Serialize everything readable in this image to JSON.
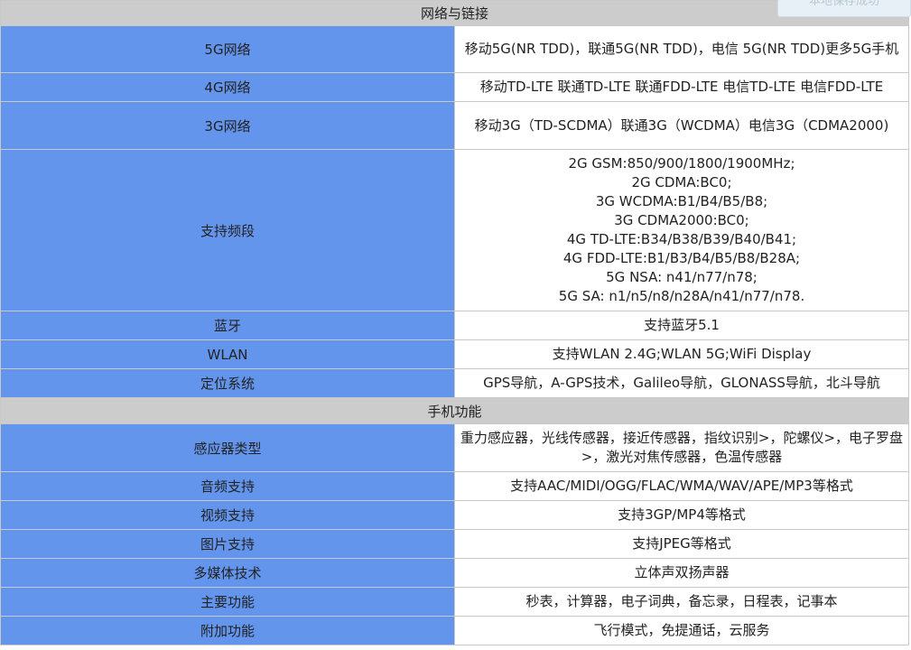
{
  "sections": [
    {
      "title": "网络与链接",
      "rows": [
        {
          "key": "5G网络",
          "value": "移动5G(NR TDD)，联通5G(NR TDD)，电信 5G(NR TDD)更多5G手机"
        },
        {
          "key": "4G网络",
          "value": "移动TD-LTE 联通TD-LTE 联通FDD-LTE 电信TD-LTE 电信FDD-LTE"
        },
        {
          "key": "3G网络",
          "value": "移动3G（TD-SCDMA）联通3G（WCDMA）电信3G（CDMA2000)"
        },
        {
          "key": "支持频段",
          "lines": [
            "2G GSM:850/900/1800/1900MHz;",
            "2G CDMA:BC0;",
            "3G WCDMA:B1/B4/B5/B8;",
            "3G CDMA2000:BC0;",
            "4G TD-LTE:B34/B38/B39/B40/B41;",
            "4G FDD-LTE:B1/B3/B4/B5/B8/B28A;",
            "5G NSA: n41/n77/n78;",
            "5G SA: n1/n5/n8/n28A/n41/n77/n78."
          ]
        },
        {
          "key": "蓝牙",
          "value": "支持蓝牙5.1"
        },
        {
          "key": "WLAN",
          "value": "支持WLAN 2.4G;WLAN 5G;WiFi Display"
        },
        {
          "key": "定位系统",
          "value": "GPS导航，A-GPS技术，Galileo导航，GLONASS导航，北斗导航"
        }
      ]
    },
    {
      "title": "手机功能",
      "rows": [
        {
          "key": "感应器类型",
          "value": "重力感应器，光线传感器，接近传感器，指纹识别>，陀螺仪>，电子罗盘>，激光对焦传感器，色温传感器"
        },
        {
          "key": "音频支持",
          "value": "支持AAC/MIDI/OGG/FLAC/WMA/WAV/APE/MP3等格式"
        },
        {
          "key": "视频支持",
          "value": "支持3GP/MP4等格式"
        },
        {
          "key": "图片支持",
          "value": "支持JPEG等格式"
        },
        {
          "key": "多媒体技术",
          "value": "立体声双扬声器"
        },
        {
          "key": "主要功能",
          "value": "秒表，计算器，电子词典，备忘录，日程表，记事本"
        },
        {
          "key": "附加功能",
          "value": "飞行模式，免提通话，云服务"
        }
      ]
    }
  ],
  "toast": {
    "text": "本地保存成功"
  }
}
